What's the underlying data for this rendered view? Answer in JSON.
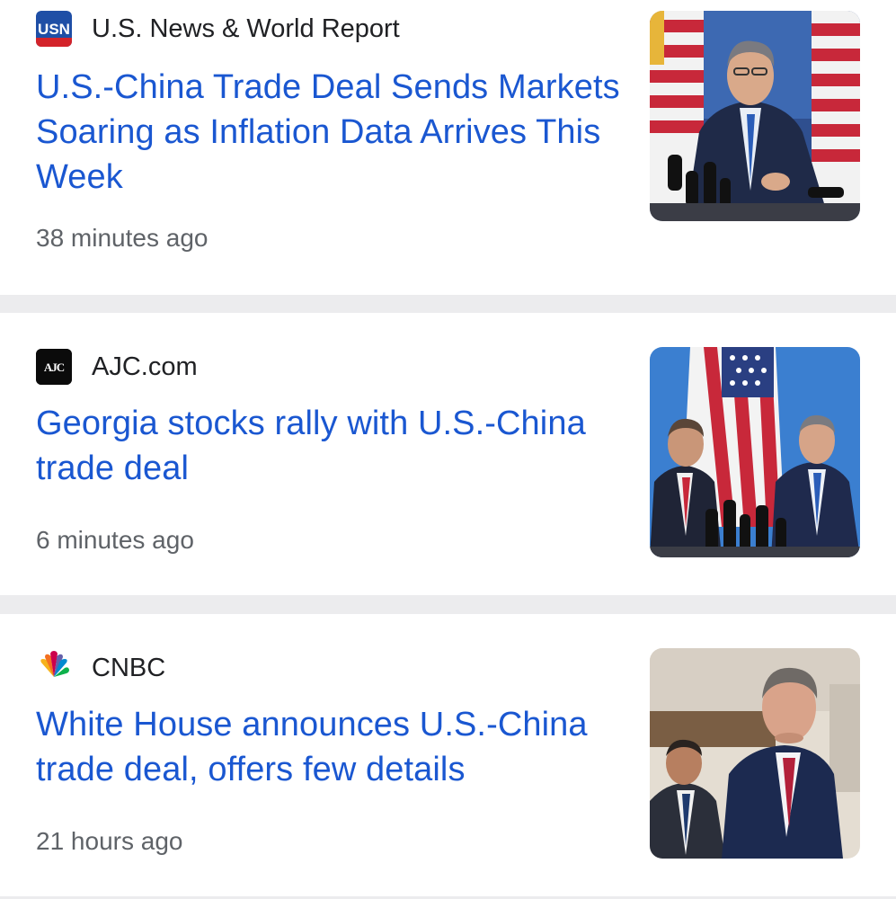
{
  "articles": [
    {
      "source": "U.S. News & World Report",
      "logo_text": "USN",
      "headline": "U.S.-China Trade Deal Sends Markets Soaring as Inflation Data Arrives This Week",
      "time": "38 minutes ago"
    },
    {
      "source": "AJC.com",
      "logo_text": "AJC",
      "headline": "Georgia stocks rally with U.S.-China trade deal",
      "time": "6 minutes ago"
    },
    {
      "source": "CNBC",
      "headline": "White House announces U.S.-China trade deal, offers few details",
      "time": "21 hours ago"
    }
  ],
  "colors": {
    "headline": "#1a57d1",
    "source": "#202124",
    "time": "#5f6368",
    "divider": "#ececee",
    "usn_blue": "#1f4fa6",
    "usn_red": "#d3232a"
  }
}
